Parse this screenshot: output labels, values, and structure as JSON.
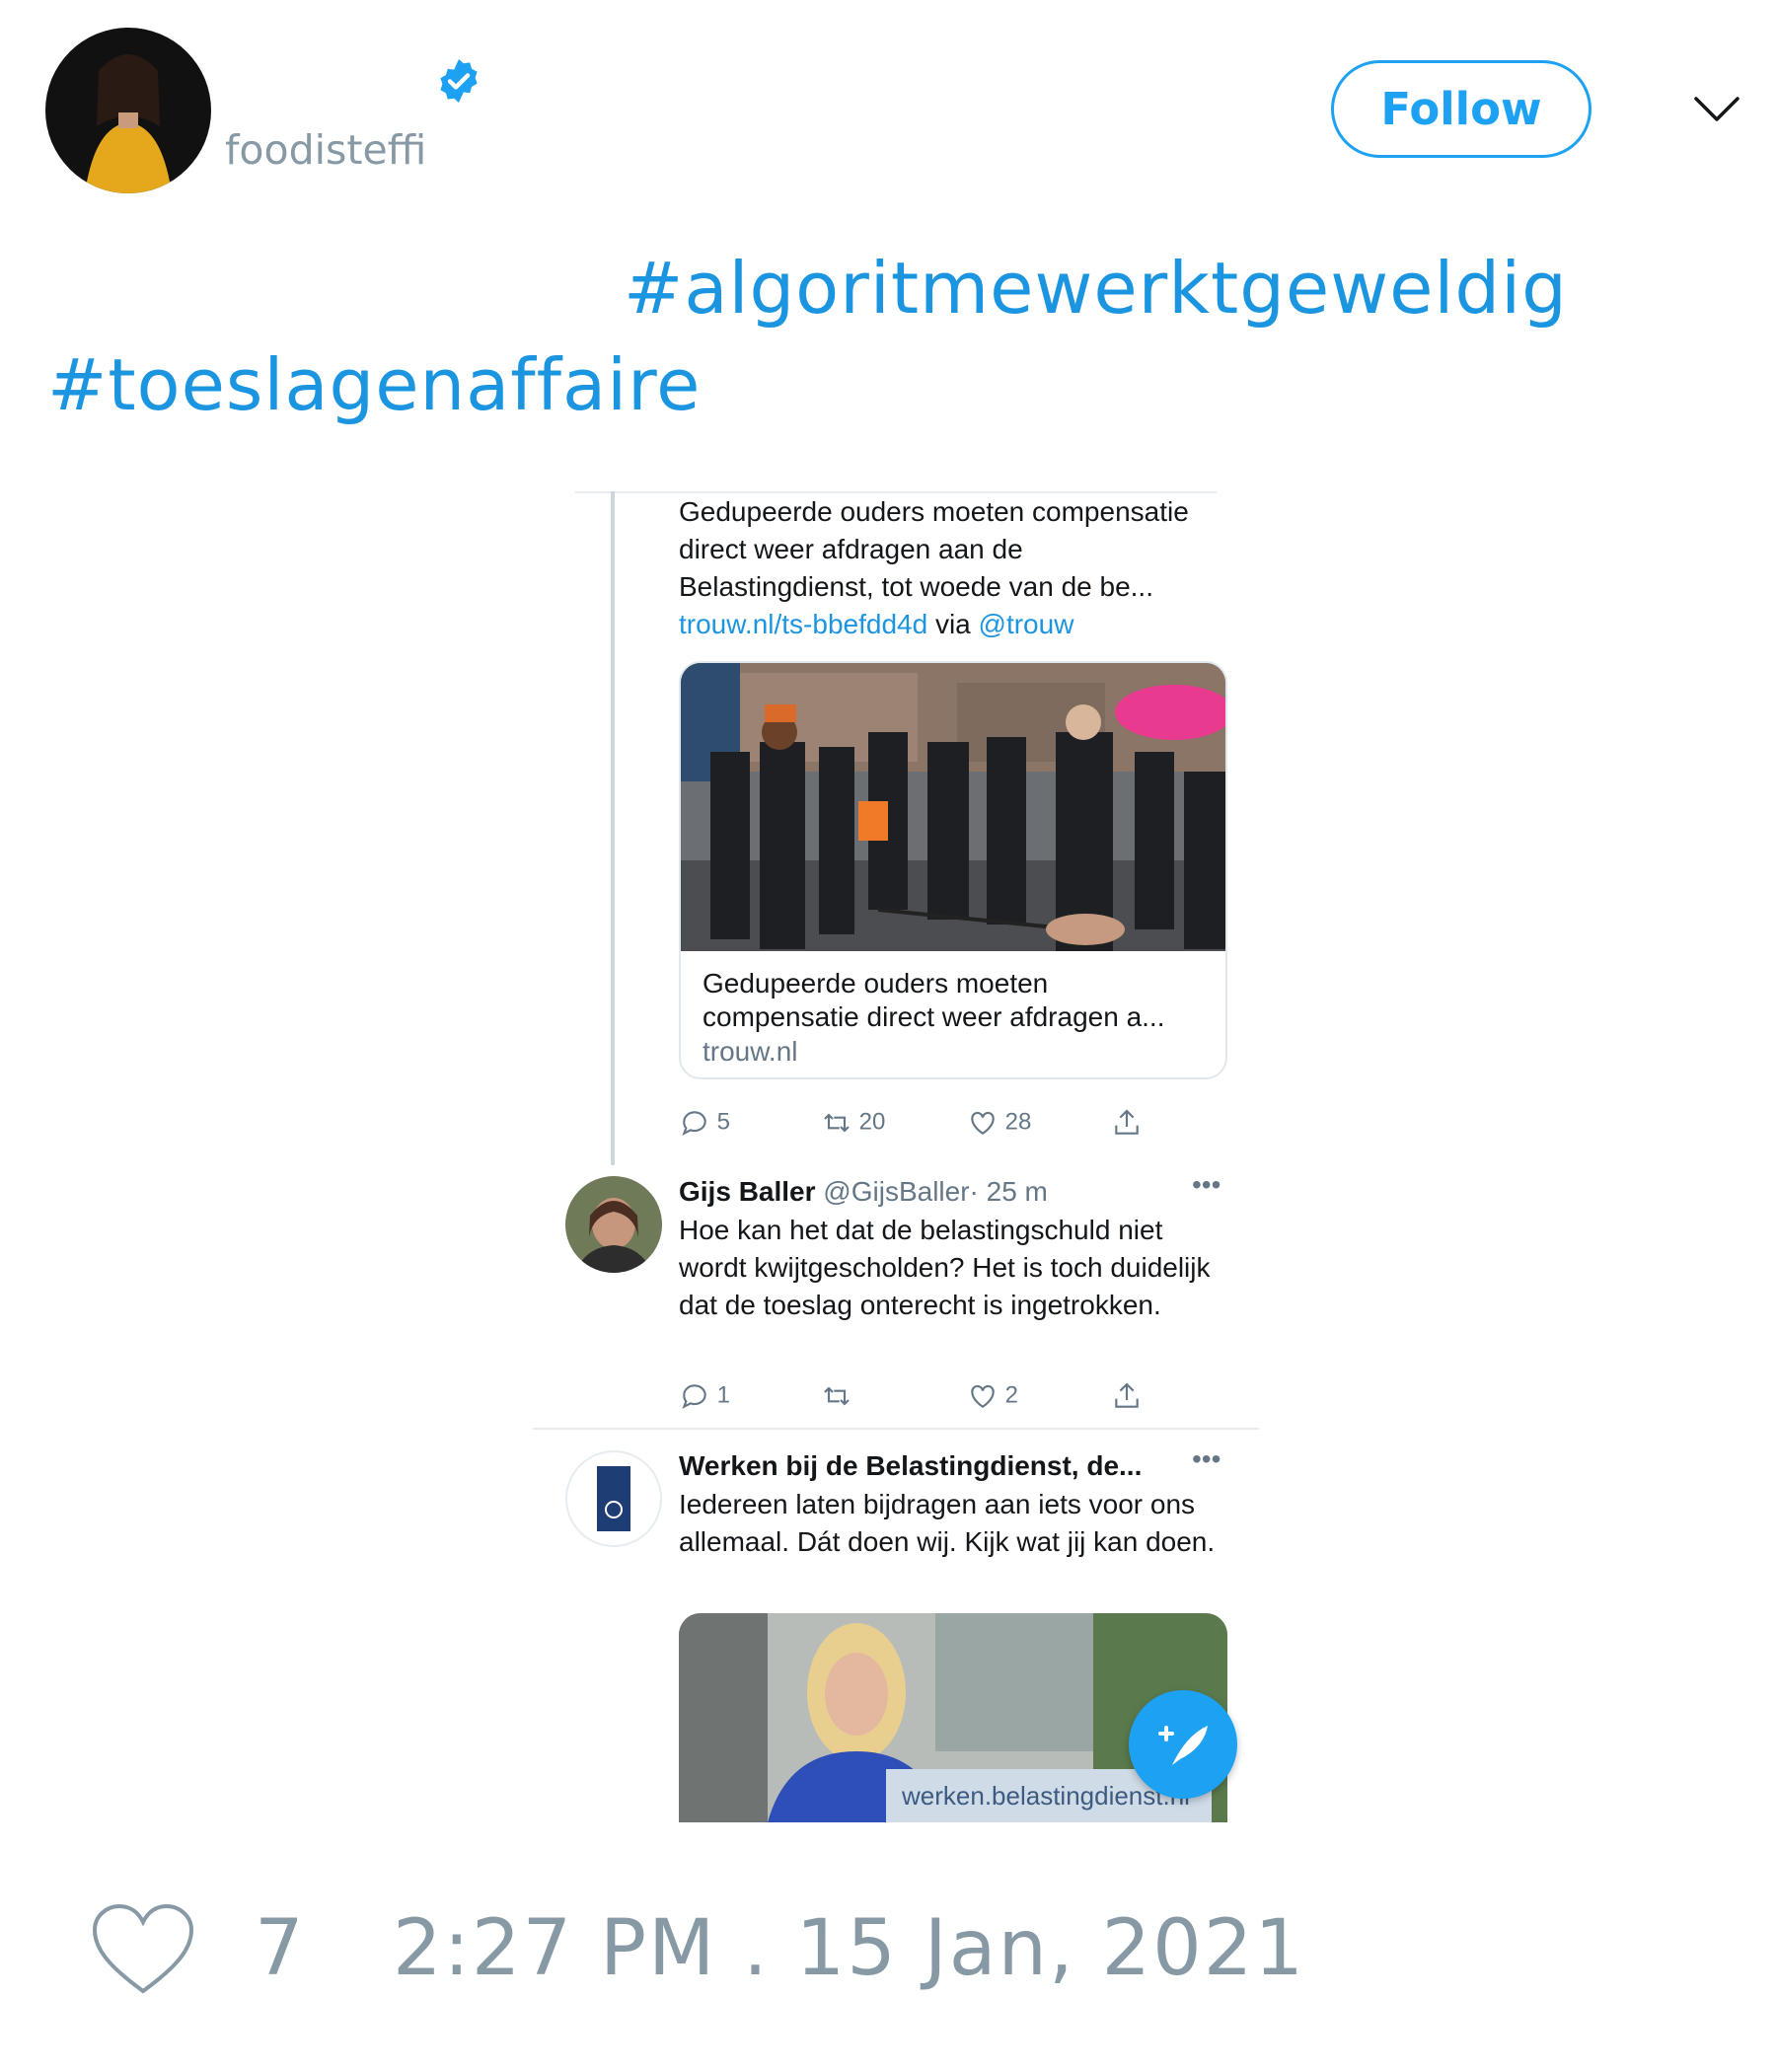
{
  "tweet": {
    "handle": "foodisteffi",
    "follow_label": "Follow",
    "hashtags": [
      "#algoritmewerktgeweldig",
      "#toeslagenaffaire"
    ],
    "likes": "7",
    "timestamp": "2:27 PM . 15 Jan, 2021"
  },
  "embedded": {
    "post1": {
      "text": "Gedupeerde ouders moeten compensatie direct weer afdragen aan de Belastingdienst, tot woede van de be...",
      "link": "trouw.nl/ts-bbefdd4d",
      "via": "via",
      "mention": "@trouw",
      "card_title": "Gedupeerde ouders moeten compensatie direct weer afdragen a...",
      "card_domain": "trouw.nl",
      "replies": "5",
      "retweets": "20",
      "likes": "28"
    },
    "post2": {
      "name": "Gijs Baller",
      "handle": "@GijsBaller",
      "time": "· 25 m",
      "text": "Hoe kan het dat de belastingschuld niet wordt kwijtgescholden? Het is toch duidelijk dat de toeslag onterecht is ingetrokken.",
      "replies": "1",
      "likes": "2"
    },
    "post3": {
      "name": "Werken bij de Belastingdienst, de...",
      "text": "Iedereen laten bijdragen aan iets voor ons allemaal. Dát doen wij. Kijk wat jij kan doen.",
      "image_caption": "werken.belastingdienst.nl"
    }
  },
  "colors": {
    "accent": "#1da1f2",
    "hashtag": "#1b95e0",
    "muted": "#8899a6"
  }
}
